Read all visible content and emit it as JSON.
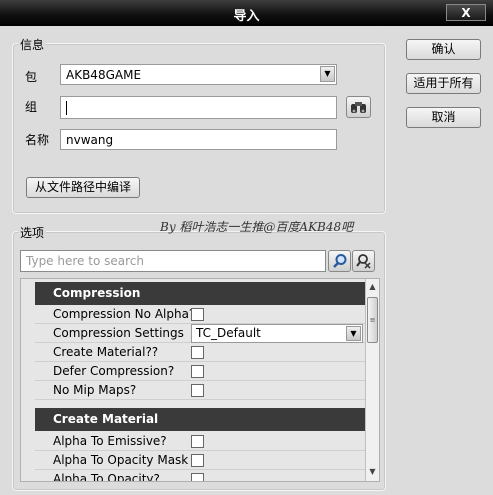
{
  "window": {
    "title": "导入",
    "close_label": "X"
  },
  "info_group": {
    "label": "信息",
    "package_label": "包",
    "package_value": "AKB48GAME",
    "group_label": "组",
    "group_value": "",
    "name_label": "名称",
    "name_value": "nvwang",
    "compile_button": "从文件路径中编译"
  },
  "side_buttons": {
    "ok": "确认",
    "apply_all": "适用于所有",
    "cancel": "取消"
  },
  "options_group": {
    "label": "选项",
    "watermark": "By 稻叶浩志一生推@百度AKB48吧",
    "search_placeholder": "Type here to search",
    "categories": [
      {
        "name": "Compression",
        "properties": [
          {
            "label": "Compression No Alpha?",
            "type": "checkbox",
            "checked": false
          },
          {
            "label": "Compression Settings",
            "type": "dropdown",
            "value": "TC_Default"
          },
          {
            "label": "Create  Material??",
            "type": "checkbox",
            "checked": false
          },
          {
            "label": "Defer Compression?",
            "type": "checkbox",
            "checked": false
          },
          {
            "label": "No Mip Maps?",
            "type": "checkbox",
            "checked": false
          }
        ]
      },
      {
        "name": "Create Material",
        "properties": [
          {
            "label": "Alpha  To  Emissive?",
            "type": "checkbox",
            "checked": false
          },
          {
            "label": "Alpha  To  Opacity  Mask",
            "type": "checkbox",
            "checked": false
          },
          {
            "label": "Alpha  To  Opacity?",
            "type": "checkbox",
            "checked": false
          }
        ]
      }
    ]
  },
  "icons": {
    "close": "close-icon",
    "find": "binoculars-icon",
    "search": "magnifier-icon",
    "clear": "clear-search-icon",
    "dropdown": "dropdown-arrow-icon"
  }
}
